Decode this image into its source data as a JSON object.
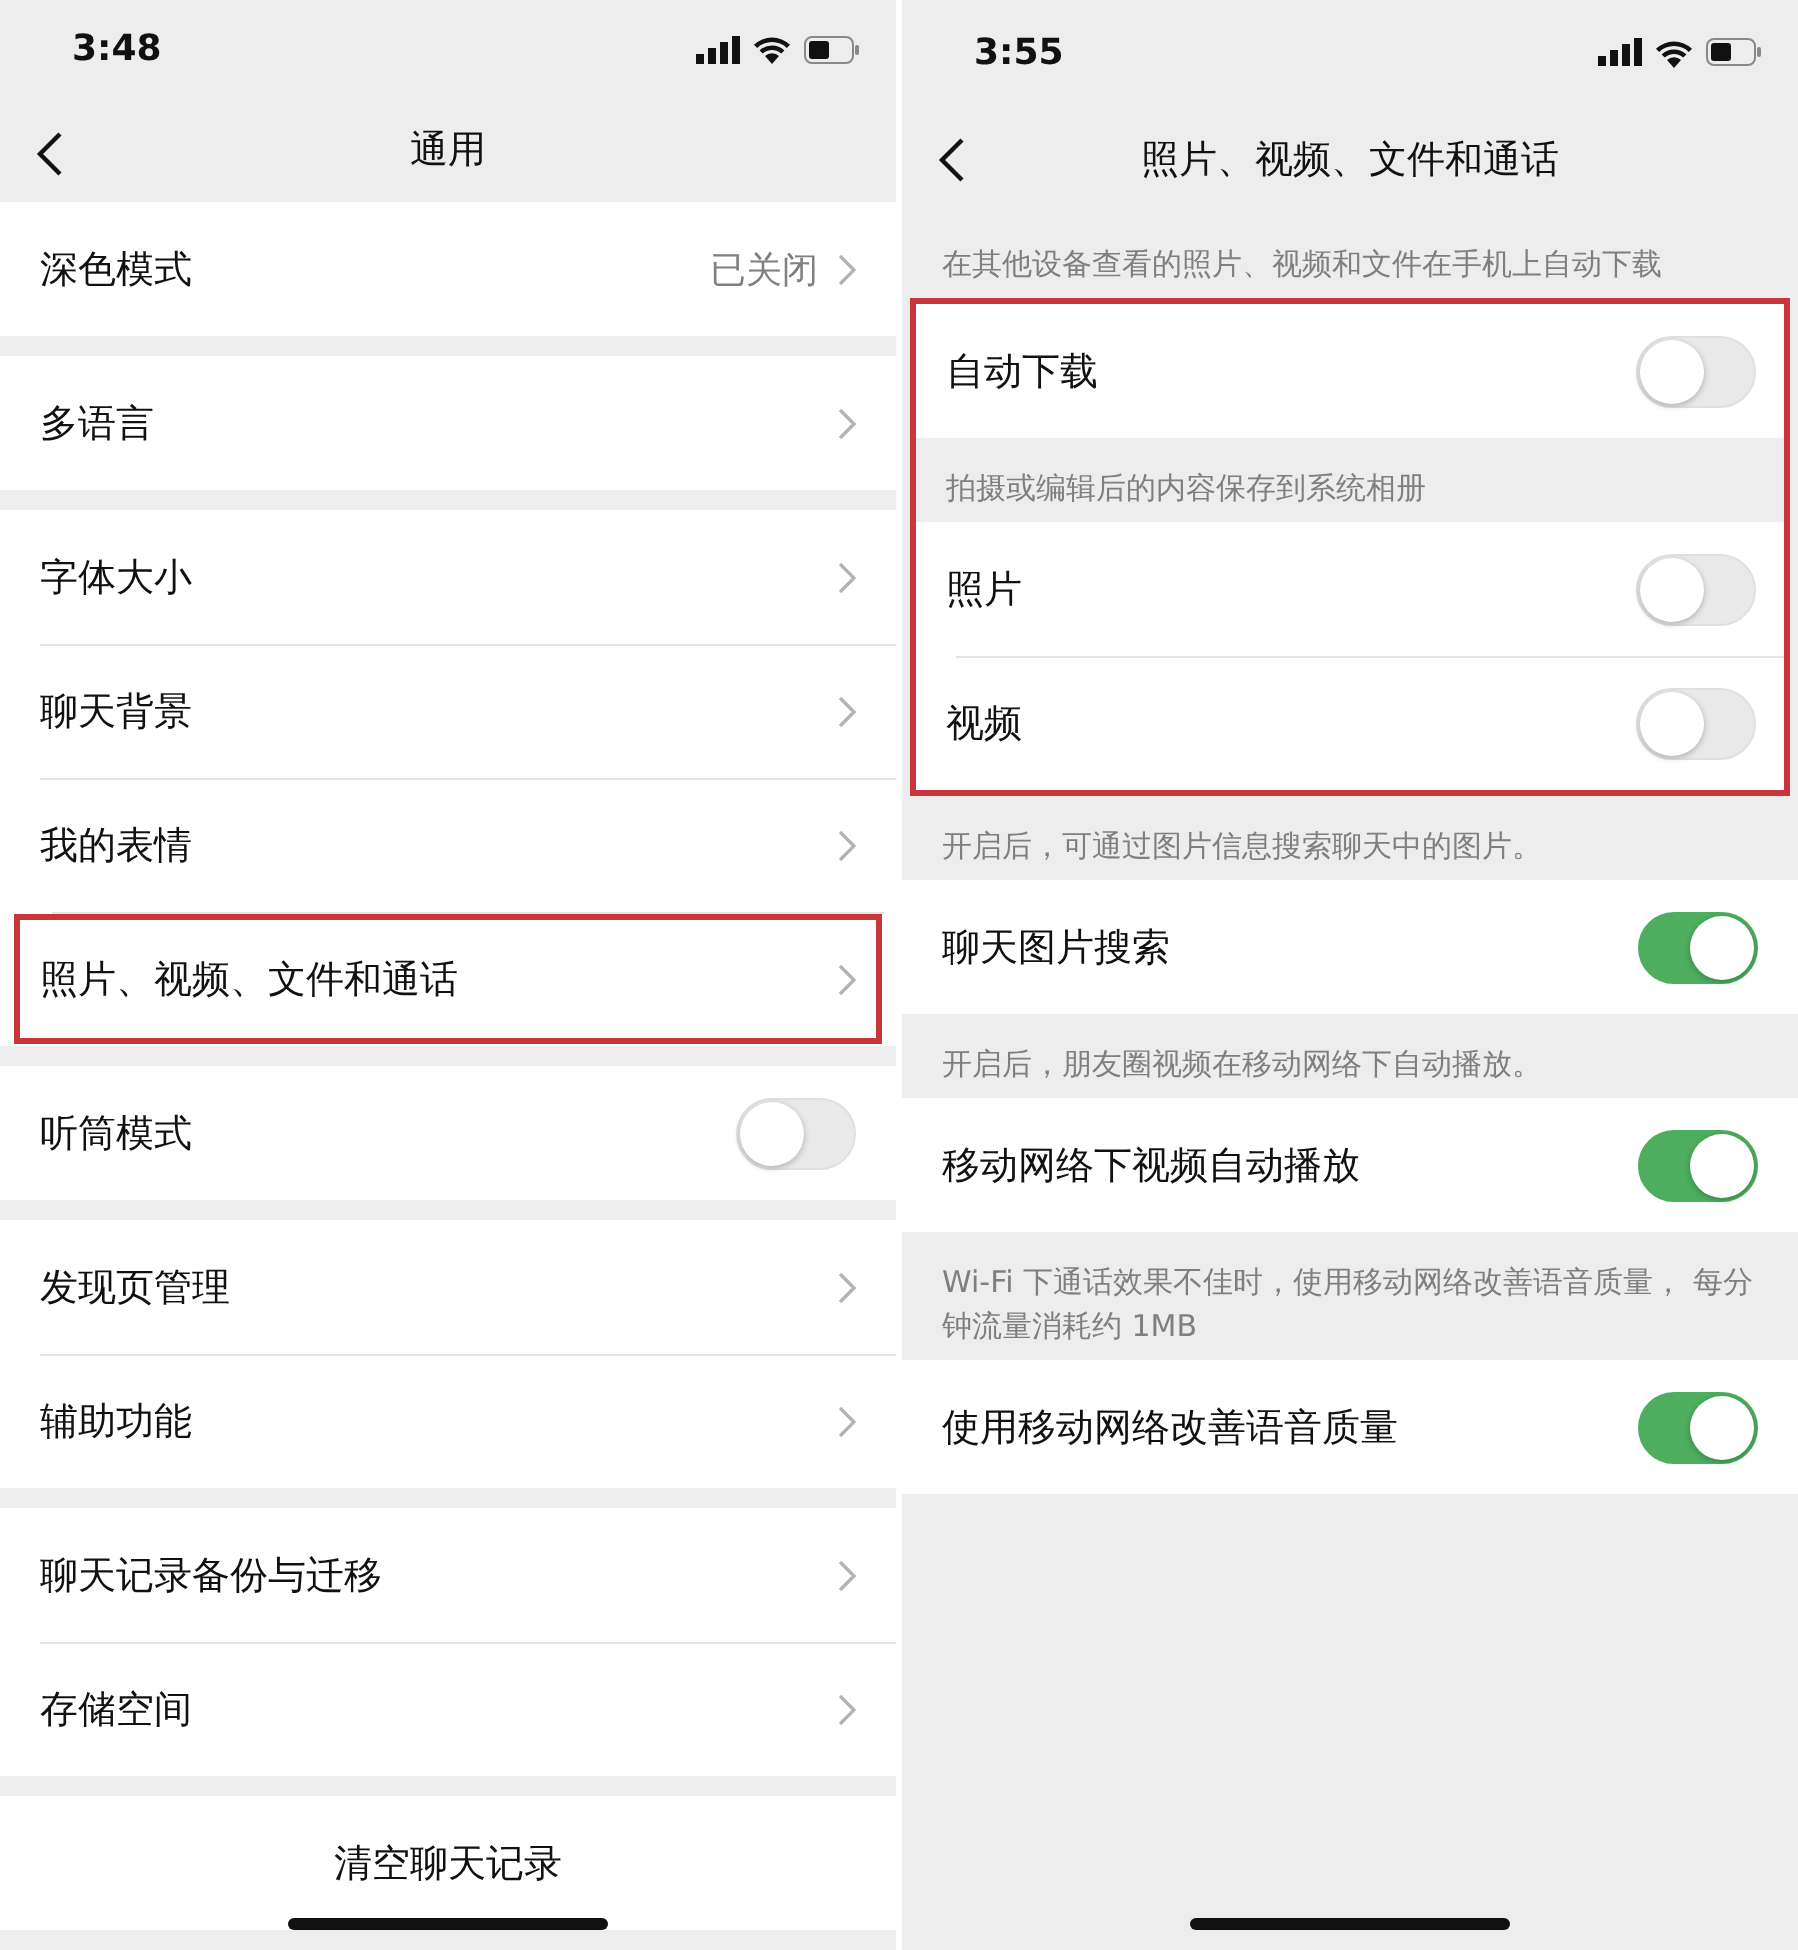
{
  "screens": [
    {
      "status_bar": {
        "time": "3:48"
      },
      "nav": {
        "title": "通用"
      },
      "groups": [
        {
          "rows": [
            {
              "kind": "link",
              "label": "深色模式",
              "value": "已关闭",
              "highlighted": false
            }
          ]
        },
        {
          "rows": [
            {
              "kind": "link",
              "label": "多语言",
              "highlighted": false
            }
          ]
        },
        {
          "rows": [
            {
              "kind": "link",
              "label": "字体大小",
              "highlighted": false
            },
            {
              "kind": "link",
              "label": "聊天背景",
              "highlighted": false
            },
            {
              "kind": "link",
              "label": "我的表情",
              "highlighted": false
            },
            {
              "kind": "link",
              "label": "照片、视频、文件和通话",
              "highlighted": true
            }
          ]
        },
        {
          "rows": [
            {
              "kind": "toggle",
              "label": "听筒模式",
              "on": false,
              "highlighted": false
            }
          ]
        },
        {
          "rows": [
            {
              "kind": "link",
              "label": "发现页管理",
              "highlighted": false
            },
            {
              "kind": "link",
              "label": "辅助功能",
              "highlighted": false
            }
          ]
        },
        {
          "rows": [
            {
              "kind": "link",
              "label": "聊天记录备份与迁移",
              "highlighted": false
            },
            {
              "kind": "link",
              "label": "存储空间",
              "highlighted": false
            }
          ]
        },
        {
          "rows": [
            {
              "kind": "action",
              "label": "清空聊天记录",
              "highlighted": false
            }
          ]
        }
      ]
    },
    {
      "status_bar": {
        "time": "3:55"
      },
      "nav": {
        "title": "照片、视频、文件和通话"
      },
      "groups": [
        {
          "highlighted": false,
          "items": [
            {
              "kind": "note",
              "text": "在其他设备查看的照片、视频和文件在手机上自动下载"
            }
          ]
        },
        {
          "highlighted": true,
          "items": [
            {
              "kind": "toggle",
              "label": "自动下载",
              "on": false
            },
            {
              "kind": "note",
              "text": "拍摄或编辑后的内容保存到系统相册"
            },
            {
              "kind": "toggle",
              "label": "照片",
              "on": false
            },
            {
              "kind": "toggle",
              "label": "视频",
              "on": false
            }
          ]
        },
        {
          "highlighted": false,
          "items": [
            {
              "kind": "note",
              "text": "开启后，可通过图片信息搜索聊天中的图片。"
            },
            {
              "kind": "toggle",
              "label": "聊天图片搜索",
              "on": true
            },
            {
              "kind": "note",
              "text": "开启后，朋友圈视频在移动网络下自动播放。"
            },
            {
              "kind": "toggle",
              "label": "移动网络下视频自动播放",
              "on": true
            },
            {
              "kind": "note",
              "text": "Wi-Fi 下通话效果不佳时，使用移动网络改善语音质量， 每分钟流量消耗约 1MB"
            },
            {
              "kind": "toggle",
              "label": "使用移动网络改善语音质量",
              "on": true
            }
          ]
        }
      ]
    }
  ]
}
